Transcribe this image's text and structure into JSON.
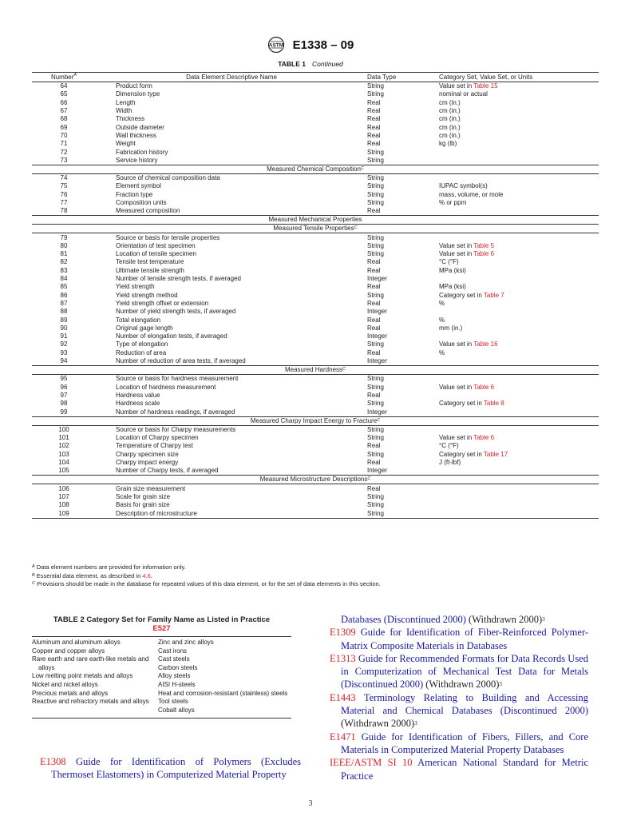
{
  "header": {
    "logo": "astm-logo-icon",
    "doc_id": "E1338 – 09"
  },
  "table1": {
    "label": "TABLE 1",
    "caption": "Continued",
    "columns": {
      "number": "Number",
      "number_sup": "A",
      "name": "Data Element Descriptive Name",
      "type": "Data Type",
      "units": "Category Set, Value Set, or Units"
    },
    "rows": [
      {
        "kind": "row",
        "num": "64",
        "name": "Product form",
        "type": "String",
        "units": "Value set in ",
        "ref": "Table 15"
      },
      {
        "kind": "row",
        "num": "65",
        "name": "Dimension type",
        "type": "String",
        "units": "nominal or actual",
        "ref": ""
      },
      {
        "kind": "row",
        "num": "66",
        "name": "Length",
        "type": "Real",
        "units": "cm (in.)",
        "ref": ""
      },
      {
        "kind": "row",
        "num": "67",
        "name": "Width",
        "type": "Real",
        "units": "cm (in.)",
        "ref": ""
      },
      {
        "kind": "row",
        "num": "68",
        "name": "Thickness",
        "type": "Real",
        "units": "cm (in.)",
        "ref": ""
      },
      {
        "kind": "row",
        "num": "69",
        "name": "Outside diameter",
        "type": "Real",
        "units": "cm (in.)",
        "ref": ""
      },
      {
        "kind": "row",
        "num": "70",
        "name": "Wall thickness",
        "type": "Real",
        "units": "cm (in.)",
        "ref": ""
      },
      {
        "kind": "row",
        "num": "71",
        "name": "Weight",
        "type": "Real",
        "units": "kg (lb)",
        "ref": ""
      },
      {
        "kind": "row",
        "num": "72",
        "name": "Fabrication history",
        "type": "String",
        "units": "",
        "ref": ""
      },
      {
        "kind": "row",
        "num": "73",
        "name": "Service history",
        "type": "String",
        "units": "",
        "ref": ""
      },
      {
        "kind": "group",
        "label": "Measured Chemical Composition",
        "sup": "C"
      },
      {
        "kind": "row",
        "num": "74",
        "name": "Source of chemical composition data",
        "type": "String",
        "units": "",
        "ref": ""
      },
      {
        "kind": "row",
        "num": "75",
        "name": "Element symbol",
        "type": "String",
        "units": "IUPAC symbol(s)",
        "ref": ""
      },
      {
        "kind": "row",
        "num": "76",
        "name": "Fraction type",
        "type": "String",
        "units": "mass, volume, or mole",
        "ref": ""
      },
      {
        "kind": "row",
        "num": "77",
        "name": "Composition units",
        "type": "String",
        "units": "% or ppm",
        "ref": ""
      },
      {
        "kind": "row",
        "num": "78",
        "name": "Measured composition",
        "type": "Real",
        "units": "",
        "ref": ""
      },
      {
        "kind": "group",
        "label": "Measured Mechanical Properties",
        "sup": ""
      },
      {
        "kind": "group",
        "label": "Measured Tensile Properties",
        "sup": "C"
      },
      {
        "kind": "row",
        "num": "79",
        "name": "Source or basis for tensile properties",
        "type": "String",
        "units": "",
        "ref": ""
      },
      {
        "kind": "row",
        "num": "80",
        "name": "Orientation of test specimen",
        "type": "String",
        "units": "Value set in ",
        "ref": "Table 5"
      },
      {
        "kind": "row",
        "num": "81",
        "name": "Location of tensile specimen",
        "type": "String",
        "units": "Value set in ",
        "ref": "Table 6"
      },
      {
        "kind": "row",
        "num": "82",
        "name": "Tensile test temperature",
        "type": "Real",
        "units": "°C (°F)",
        "ref": ""
      },
      {
        "kind": "row",
        "num": "83",
        "name": "Ultimate tensile strength",
        "type": "Real",
        "units": "MPa (ksi)",
        "ref": ""
      },
      {
        "kind": "row",
        "num": "84",
        "name": "Number of tensile strength tests, if averaged",
        "type": "Integer",
        "units": "",
        "ref": ""
      },
      {
        "kind": "row",
        "num": "85",
        "name": "Yield strength",
        "type": "Real",
        "units": "MPa (ksi)",
        "ref": ""
      },
      {
        "kind": "row",
        "num": "86",
        "name": "Yield strength method",
        "type": "String",
        "units": "Category set in ",
        "ref": "Table 7"
      },
      {
        "kind": "row",
        "num": "87",
        "name": "Yield strength offset or extension",
        "type": "Real",
        "units": "%",
        "ref": ""
      },
      {
        "kind": "row",
        "num": "88",
        "name": "Number of yield strength tests, if averaged",
        "type": "Integer",
        "units": "",
        "ref": ""
      },
      {
        "kind": "row",
        "num": "89",
        "name": "Total elongation",
        "type": "Real",
        "units": "%",
        "ref": ""
      },
      {
        "kind": "row",
        "num": "90",
        "name": "Original gage length",
        "type": "Real",
        "units": "mm (in.)",
        "ref": ""
      },
      {
        "kind": "row",
        "num": "91",
        "name": "Number of elongation tests, if averaged",
        "type": "Integer",
        "units": "",
        "ref": ""
      },
      {
        "kind": "row",
        "num": "92",
        "name": "Type of elongation",
        "type": "String",
        "units": "Value set in ",
        "ref": "Table 16"
      },
      {
        "kind": "row",
        "num": "93",
        "name": "Reduction of area",
        "type": "Real",
        "units": "%",
        "ref": ""
      },
      {
        "kind": "row",
        "num": "94",
        "name": "Number of reduction of area tests, if averaged",
        "type": "Integer",
        "units": "",
        "ref": ""
      },
      {
        "kind": "group",
        "label": "Measured Hardness",
        "sup": "C"
      },
      {
        "kind": "row",
        "num": "95",
        "name": "Source or basis for hardness measurement",
        "type": "String",
        "units": "",
        "ref": ""
      },
      {
        "kind": "row",
        "num": "96",
        "name": "Location of hardness measurement",
        "type": "String",
        "units": "Value set in ",
        "ref": "Table 6"
      },
      {
        "kind": "row",
        "num": "97",
        "name": "Hardness value",
        "type": "Real",
        "units": "",
        "ref": ""
      },
      {
        "kind": "row",
        "num": "98",
        "name": "Hardness scale",
        "type": "String",
        "units": "Category set in ",
        "ref": "Table 8"
      },
      {
        "kind": "row",
        "num": "99",
        "name": "Number of hardness readings, if averaged",
        "type": "Integer",
        "units": "",
        "ref": ""
      },
      {
        "kind": "group",
        "label": "Measured Charpy Impact Energy to Fracture",
        "sup": "C"
      },
      {
        "kind": "row",
        "num": "100",
        "name": "Source or basis for Charpy measurements",
        "type": "String",
        "units": "",
        "ref": ""
      },
      {
        "kind": "row",
        "num": "101",
        "name": "Location of Charpy specimen",
        "type": "String",
        "units": "Value set in ",
        "ref": "Table 6"
      },
      {
        "kind": "row",
        "num": "102",
        "name": "Temperature of Charpy test",
        "type": "Real",
        "units": "°C (°F)",
        "ref": ""
      },
      {
        "kind": "row",
        "num": "103",
        "name": "Charpy specimen size",
        "type": "String",
        "units": "Category set in ",
        "ref": "Table 17"
      },
      {
        "kind": "row",
        "num": "104",
        "name": "Charpy impact energy",
        "type": "Real",
        "units": "J (ft-lbf)",
        "ref": ""
      },
      {
        "kind": "row",
        "num": "105",
        "name": "Number of Charpy tests, if averaged",
        "type": "Integer",
        "units": "",
        "ref": ""
      },
      {
        "kind": "group",
        "label": "Measured Microstructure Descriptions",
        "sup": "C"
      },
      {
        "kind": "row",
        "num": "106",
        "name": "Grain size measurement",
        "type": "Real",
        "units": "",
        "ref": ""
      },
      {
        "kind": "row",
        "num": "107",
        "name": "Scale for grain size",
        "type": "String",
        "units": "",
        "ref": ""
      },
      {
        "kind": "row",
        "num": "108",
        "name": "Basis for grain size",
        "type": "String",
        "units": "",
        "ref": ""
      },
      {
        "kind": "row",
        "num": "109",
        "name": "Description of microstructure",
        "type": "String",
        "units": "",
        "ref": ""
      }
    ],
    "footnotes": [
      {
        "mark": "A",
        "text": "Data element numbers are provided for information only.",
        "link": "",
        "after": ""
      },
      {
        "mark": "B",
        "text": "Essential data element, as described in ",
        "link": "4.6",
        "after": "."
      },
      {
        "mark": "C",
        "text": "Provisions should be made in the database for repeated values of this data element, or for the set of data elements in this section.",
        "link": "",
        "after": ""
      }
    ]
  },
  "table2": {
    "title": "TABLE 2 Category Set for Family Name as Listed in Practice",
    "title_ref": "E527",
    "col1": [
      "Aluminum and aluminum alloys",
      "Copper and copper alloys",
      "Rare earth and rare earth-like metals and alloys",
      "Low melting point metals and alloys",
      "Nickel and nickel alloys",
      "Precious metals and alloys",
      "Reactive and refractory metals and alloys"
    ],
    "col2": [
      "Zinc and zinc alloys",
      "Cast irons",
      "Cast steels",
      "Carbon steels",
      "Alloy steels",
      "AISI H-steels",
      "Heat and corrosion-resistant (stainless) steels",
      "Tool steels",
      "Cobalt alloys"
    ]
  },
  "references": {
    "e1308": {
      "code": "E1308",
      "title": "Guide for Identification of Polymers (Excludes Thermoset Elastomers) in Computerized Material Property",
      "cont": "Databases (Discontinued 2000)",
      "status": "(Withdrawn 2000)",
      "sup": "3"
    },
    "e1309": {
      "code": "E1309",
      "title": "Guide for Identification of Fiber-Reinforced Polymer-Matrix Composite Materials in Databases"
    },
    "e1313": {
      "code": "E1313",
      "title": "Guide for Recommended Formats for Data Records Used in Computerization of Mechanical Test Data for Metals (Discontinued 2000)",
      "status": "(Withdrawn 2000)",
      "sup": "3"
    },
    "e1443": {
      "code": "E1443",
      "title": "Terminology Relating to Building and Accessing Material and Chemical Databases (Discontinued 2000)",
      "status": "(Withdrawn 2000)",
      "sup": "3"
    },
    "e1471": {
      "code": "E1471",
      "title": "Guide for Identification of Fibers, Fillers, and Core Materials in Computerized Material Property Databases"
    },
    "si10": {
      "code": "IEEE/ASTM SI 10",
      "title": "American National Standard for Metric Practice"
    }
  },
  "page_number": "3",
  "colors": {
    "link_red": "#d6232a",
    "link_blue": "#1a1aa0",
    "text": "#222222"
  }
}
